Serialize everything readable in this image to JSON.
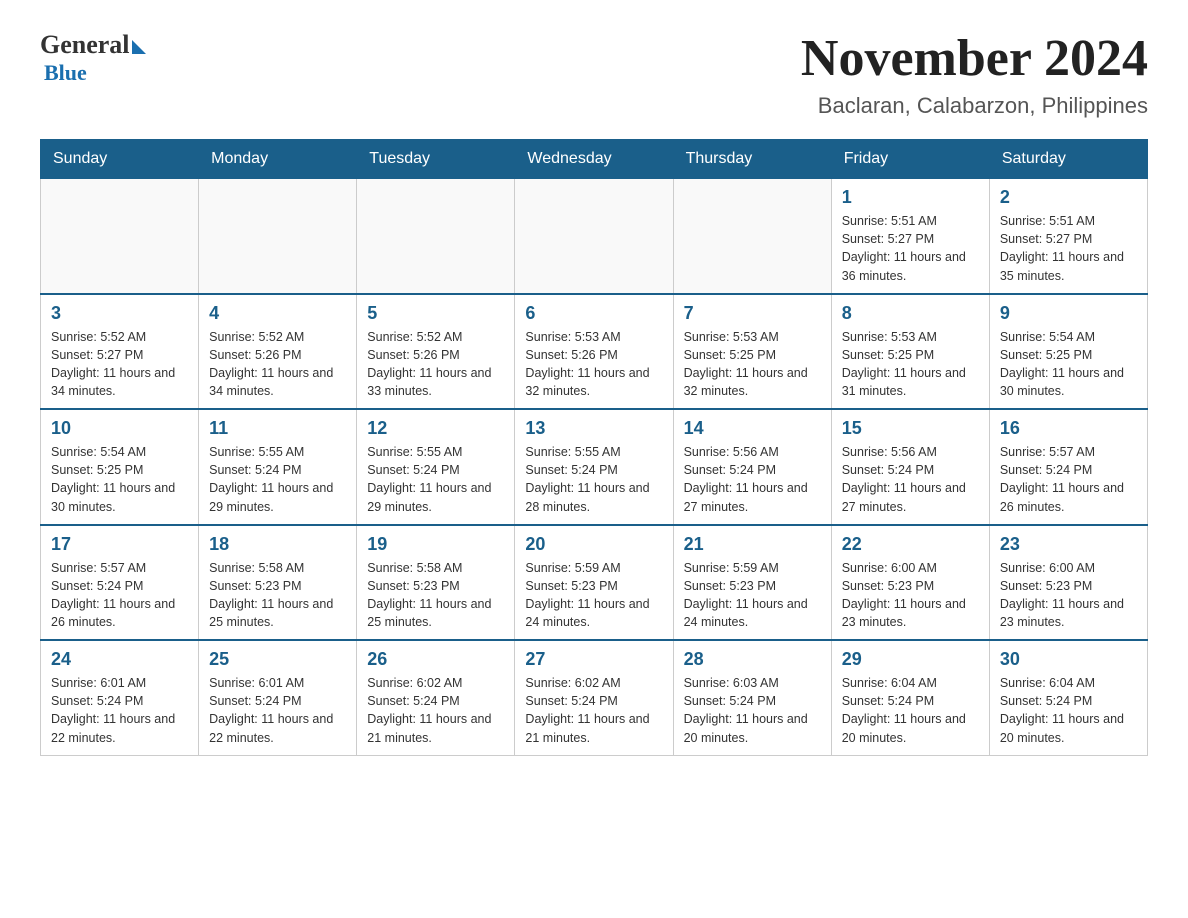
{
  "logo": {
    "general": "General",
    "blue": "Blue"
  },
  "header": {
    "title": "November 2024",
    "subtitle": "Baclaran, Calabarzon, Philippines"
  },
  "days_of_week": [
    "Sunday",
    "Monday",
    "Tuesday",
    "Wednesday",
    "Thursday",
    "Friday",
    "Saturday"
  ],
  "weeks": [
    [
      {
        "day": "",
        "info": ""
      },
      {
        "day": "",
        "info": ""
      },
      {
        "day": "",
        "info": ""
      },
      {
        "day": "",
        "info": ""
      },
      {
        "day": "",
        "info": ""
      },
      {
        "day": "1",
        "info": "Sunrise: 5:51 AM\nSunset: 5:27 PM\nDaylight: 11 hours and 36 minutes."
      },
      {
        "day": "2",
        "info": "Sunrise: 5:51 AM\nSunset: 5:27 PM\nDaylight: 11 hours and 35 minutes."
      }
    ],
    [
      {
        "day": "3",
        "info": "Sunrise: 5:52 AM\nSunset: 5:27 PM\nDaylight: 11 hours and 34 minutes."
      },
      {
        "day": "4",
        "info": "Sunrise: 5:52 AM\nSunset: 5:26 PM\nDaylight: 11 hours and 34 minutes."
      },
      {
        "day": "5",
        "info": "Sunrise: 5:52 AM\nSunset: 5:26 PM\nDaylight: 11 hours and 33 minutes."
      },
      {
        "day": "6",
        "info": "Sunrise: 5:53 AM\nSunset: 5:26 PM\nDaylight: 11 hours and 32 minutes."
      },
      {
        "day": "7",
        "info": "Sunrise: 5:53 AM\nSunset: 5:25 PM\nDaylight: 11 hours and 32 minutes."
      },
      {
        "day": "8",
        "info": "Sunrise: 5:53 AM\nSunset: 5:25 PM\nDaylight: 11 hours and 31 minutes."
      },
      {
        "day": "9",
        "info": "Sunrise: 5:54 AM\nSunset: 5:25 PM\nDaylight: 11 hours and 30 minutes."
      }
    ],
    [
      {
        "day": "10",
        "info": "Sunrise: 5:54 AM\nSunset: 5:25 PM\nDaylight: 11 hours and 30 minutes."
      },
      {
        "day": "11",
        "info": "Sunrise: 5:55 AM\nSunset: 5:24 PM\nDaylight: 11 hours and 29 minutes."
      },
      {
        "day": "12",
        "info": "Sunrise: 5:55 AM\nSunset: 5:24 PM\nDaylight: 11 hours and 29 minutes."
      },
      {
        "day": "13",
        "info": "Sunrise: 5:55 AM\nSunset: 5:24 PM\nDaylight: 11 hours and 28 minutes."
      },
      {
        "day": "14",
        "info": "Sunrise: 5:56 AM\nSunset: 5:24 PM\nDaylight: 11 hours and 27 minutes."
      },
      {
        "day": "15",
        "info": "Sunrise: 5:56 AM\nSunset: 5:24 PM\nDaylight: 11 hours and 27 minutes."
      },
      {
        "day": "16",
        "info": "Sunrise: 5:57 AM\nSunset: 5:24 PM\nDaylight: 11 hours and 26 minutes."
      }
    ],
    [
      {
        "day": "17",
        "info": "Sunrise: 5:57 AM\nSunset: 5:24 PM\nDaylight: 11 hours and 26 minutes."
      },
      {
        "day": "18",
        "info": "Sunrise: 5:58 AM\nSunset: 5:23 PM\nDaylight: 11 hours and 25 minutes."
      },
      {
        "day": "19",
        "info": "Sunrise: 5:58 AM\nSunset: 5:23 PM\nDaylight: 11 hours and 25 minutes."
      },
      {
        "day": "20",
        "info": "Sunrise: 5:59 AM\nSunset: 5:23 PM\nDaylight: 11 hours and 24 minutes."
      },
      {
        "day": "21",
        "info": "Sunrise: 5:59 AM\nSunset: 5:23 PM\nDaylight: 11 hours and 24 minutes."
      },
      {
        "day": "22",
        "info": "Sunrise: 6:00 AM\nSunset: 5:23 PM\nDaylight: 11 hours and 23 minutes."
      },
      {
        "day": "23",
        "info": "Sunrise: 6:00 AM\nSunset: 5:23 PM\nDaylight: 11 hours and 23 minutes."
      }
    ],
    [
      {
        "day": "24",
        "info": "Sunrise: 6:01 AM\nSunset: 5:24 PM\nDaylight: 11 hours and 22 minutes."
      },
      {
        "day": "25",
        "info": "Sunrise: 6:01 AM\nSunset: 5:24 PM\nDaylight: 11 hours and 22 minutes."
      },
      {
        "day": "26",
        "info": "Sunrise: 6:02 AM\nSunset: 5:24 PM\nDaylight: 11 hours and 21 minutes."
      },
      {
        "day": "27",
        "info": "Sunrise: 6:02 AM\nSunset: 5:24 PM\nDaylight: 11 hours and 21 minutes."
      },
      {
        "day": "28",
        "info": "Sunrise: 6:03 AM\nSunset: 5:24 PM\nDaylight: 11 hours and 20 minutes."
      },
      {
        "day": "29",
        "info": "Sunrise: 6:04 AM\nSunset: 5:24 PM\nDaylight: 11 hours and 20 minutes."
      },
      {
        "day": "30",
        "info": "Sunrise: 6:04 AM\nSunset: 5:24 PM\nDaylight: 11 hours and 20 minutes."
      }
    ]
  ]
}
